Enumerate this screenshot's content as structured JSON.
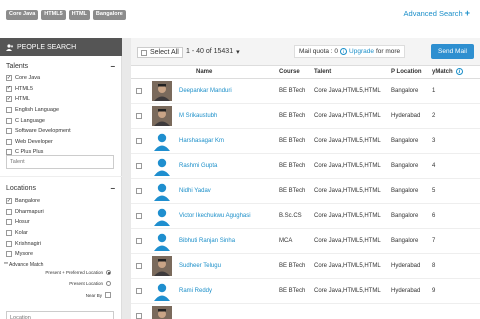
{
  "tags": [
    "Core Java",
    "HTML5",
    "HTML",
    "Bangalore"
  ],
  "advanced_search_label": "Advanced Search",
  "sidebar": {
    "header": "PEOPLE SEARCH",
    "talents_title": "Talents",
    "talents": [
      {
        "label": "Core Java",
        "checked": true
      },
      {
        "label": "HTML5",
        "checked": true
      },
      {
        "label": "HTML",
        "checked": true
      },
      {
        "label": "English Language",
        "checked": false
      },
      {
        "label": "C Language",
        "checked": false
      },
      {
        "label": "Software Development",
        "checked": false
      },
      {
        "label": "Web Developer",
        "checked": false
      },
      {
        "label": "C Plus Plus",
        "checked": false
      }
    ],
    "talent_placeholder": "Talent",
    "locations_title": "Locations",
    "locations": [
      {
        "label": "Bangalore",
        "checked": true
      },
      {
        "label": "Dharmapuri",
        "checked": false
      },
      {
        "label": "Hosur",
        "checked": false
      },
      {
        "label": "Kolar",
        "checked": false
      },
      {
        "label": "Krishnagiri",
        "checked": false
      },
      {
        "label": "Mysore",
        "checked": false
      }
    ],
    "advance_match_title": "** Advance Match",
    "advance_options": [
      {
        "label": "Present + Preferred Location",
        "kind": "radio",
        "on": true
      },
      {
        "label": "Present Location",
        "kind": "radio",
        "on": false
      },
      {
        "label": "Near By",
        "kind": "checkbox",
        "on": false
      }
    ],
    "location_placeholder": "Location"
  },
  "toolbar": {
    "select_all": "Select All",
    "range": "1 - 40 of 15431",
    "range_caret": "▾",
    "quota_label": "Mail quota : 0",
    "upgrade": "Upgrade",
    "quota_suffix": "for more",
    "send_mail": "Send Mail"
  },
  "table": {
    "headers": {
      "name": "Name",
      "course": "Course",
      "talent": "Talent",
      "location": "P Location",
      "match": "yMatch"
    },
    "rows": [
      {
        "name": "Deepankar Manduri",
        "course": "BE BTech",
        "talent": "Core Java,HTML5,HTML",
        "location": "Bangalore",
        "match": "1",
        "avatar": "photo"
      },
      {
        "name": "M Srikaustubh",
        "course": "BE BTech",
        "talent": "Core Java,HTML5,HTML",
        "location": "Hyderabad",
        "match": "2",
        "avatar": "photo"
      },
      {
        "name": "Harshasagar Km",
        "course": "BE BTech",
        "talent": "Core Java,HTML5,HTML",
        "location": "Bangalore",
        "match": "3",
        "avatar": "default"
      },
      {
        "name": "Rashmi Gupta",
        "course": "BE BTech",
        "talent": "Core Java,HTML5,HTML",
        "location": "Bangalore",
        "match": "4",
        "avatar": "default"
      },
      {
        "name": "Nidhi Yadav",
        "course": "BE BTech",
        "talent": "Core Java,HTML5,HTML",
        "location": "Bangalore",
        "match": "5",
        "avatar": "default"
      },
      {
        "name": "Victor Ikechukwu Agughasi",
        "course": "B.Sc.CS",
        "talent": "Core Java,HTML5,HTML",
        "location": "Bangalore",
        "match": "6",
        "avatar": "default"
      },
      {
        "name": "Bibhuti Ranjan Sinha",
        "course": "MCA",
        "talent": "Core Java,HTML5,HTML",
        "location": "Bangalore",
        "match": "7",
        "avatar": "default"
      },
      {
        "name": "Sudheer Telugu",
        "course": "BE BTech",
        "talent": "Core Java,HTML5,HTML",
        "location": "Hyderabad",
        "match": "8",
        "avatar": "photo"
      },
      {
        "name": "Rami Reddy",
        "course": "BE BTech",
        "talent": "Core Java,HTML5,HTML",
        "location": "Hyderabad",
        "match": "9",
        "avatar": "default"
      },
      {
        "name": "",
        "course": "",
        "talent": "",
        "location": "",
        "match": "",
        "avatar": "photo"
      }
    ]
  },
  "colors": {
    "accent": "#1b8fc9",
    "button": "#2e8fd0",
    "sidebar_header": "#555555",
    "tag": "#8c8c8c"
  }
}
